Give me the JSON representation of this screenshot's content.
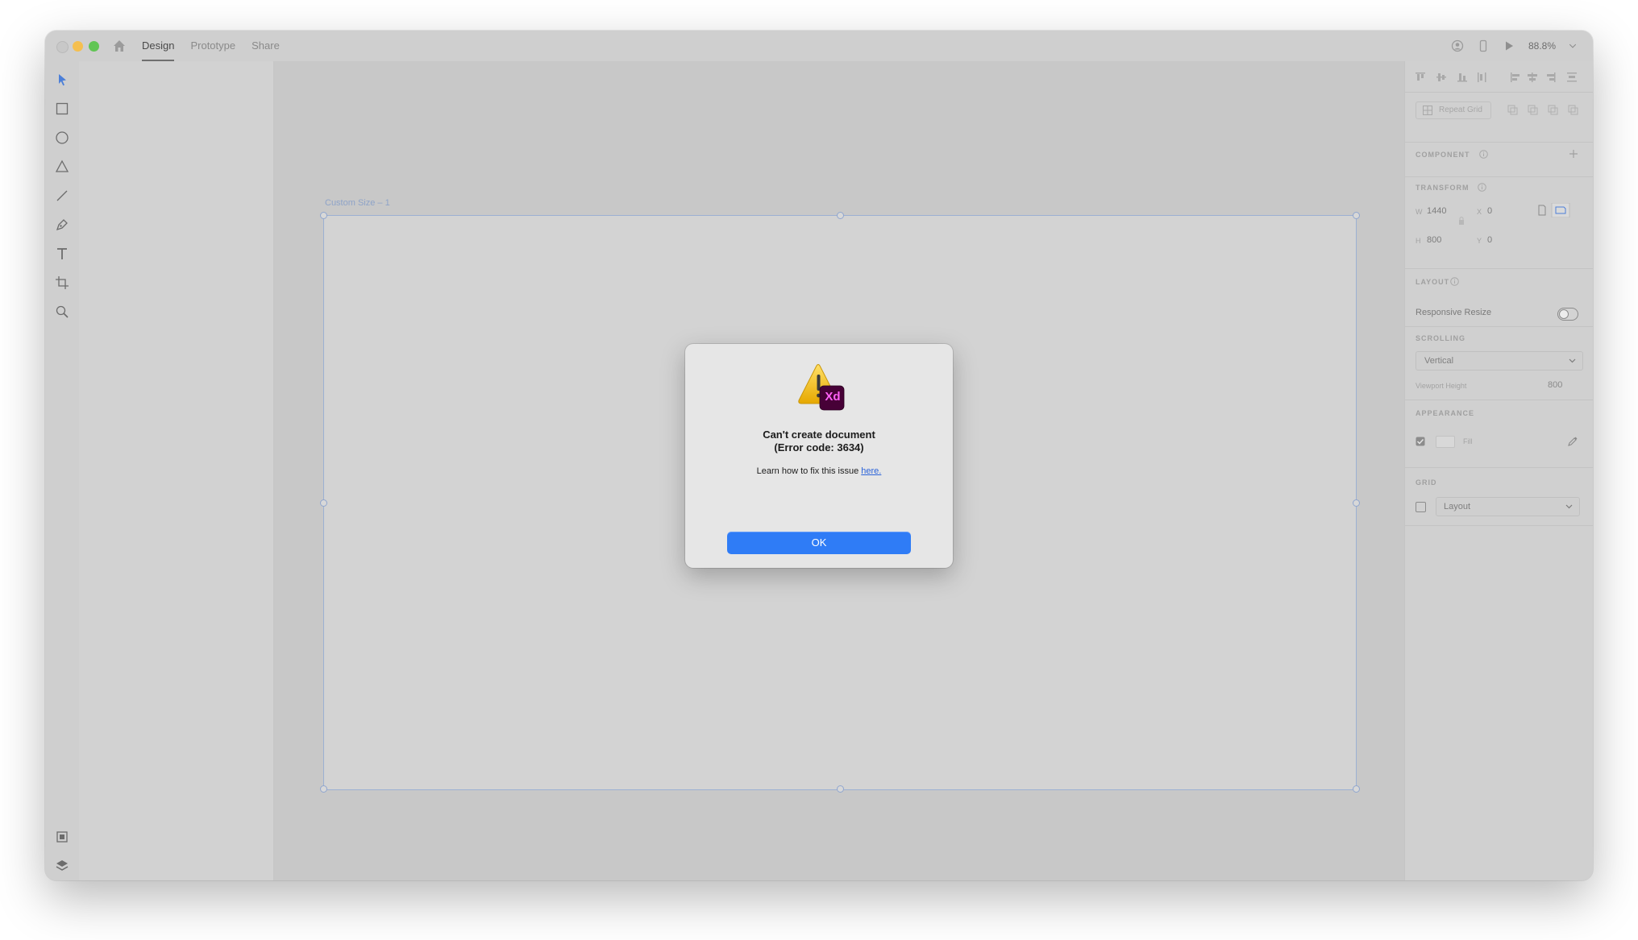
{
  "titlebar": {
    "tabs": [
      {
        "label": "Design",
        "active": true
      },
      {
        "label": "Prototype",
        "active": false
      },
      {
        "label": "Share",
        "active": false
      }
    ],
    "zoom": "88.8%"
  },
  "canvas": {
    "artboard_label": "Custom Size – 1"
  },
  "inspector": {
    "repeat_grid": "Repeat Grid",
    "component_head": "COMPONENT",
    "transform_head": "TRANSFORM",
    "w_label": "W",
    "w_value": "1440",
    "h_label": "H",
    "h_value": "800",
    "x_label": "X",
    "x_value": "0",
    "y_label": "Y",
    "y_value": "0",
    "layout_head": "LAYOUT",
    "responsive_resize": "Responsive Resize",
    "scrolling_head": "SCROLLING",
    "scrolling_value": "Vertical",
    "viewport_height_label": "Viewport Height",
    "viewport_height_value": "800",
    "appearance_head": "APPEARANCE",
    "fill_label": "Fill",
    "grid_head": "GRID",
    "grid_value": "Layout"
  },
  "dialog": {
    "badge": "Xd",
    "title_line1": "Can't create document",
    "title_line2": "(Error code: 3634)",
    "message": "Learn how to fix this issue ",
    "link": "here.",
    "ok": "OK"
  },
  "colors": {
    "accent": "#2f7cf6",
    "xd_badge_bg": "#470137",
    "xd_badge_text": "#ff61f6",
    "warning_yellow": "#f2c200"
  }
}
